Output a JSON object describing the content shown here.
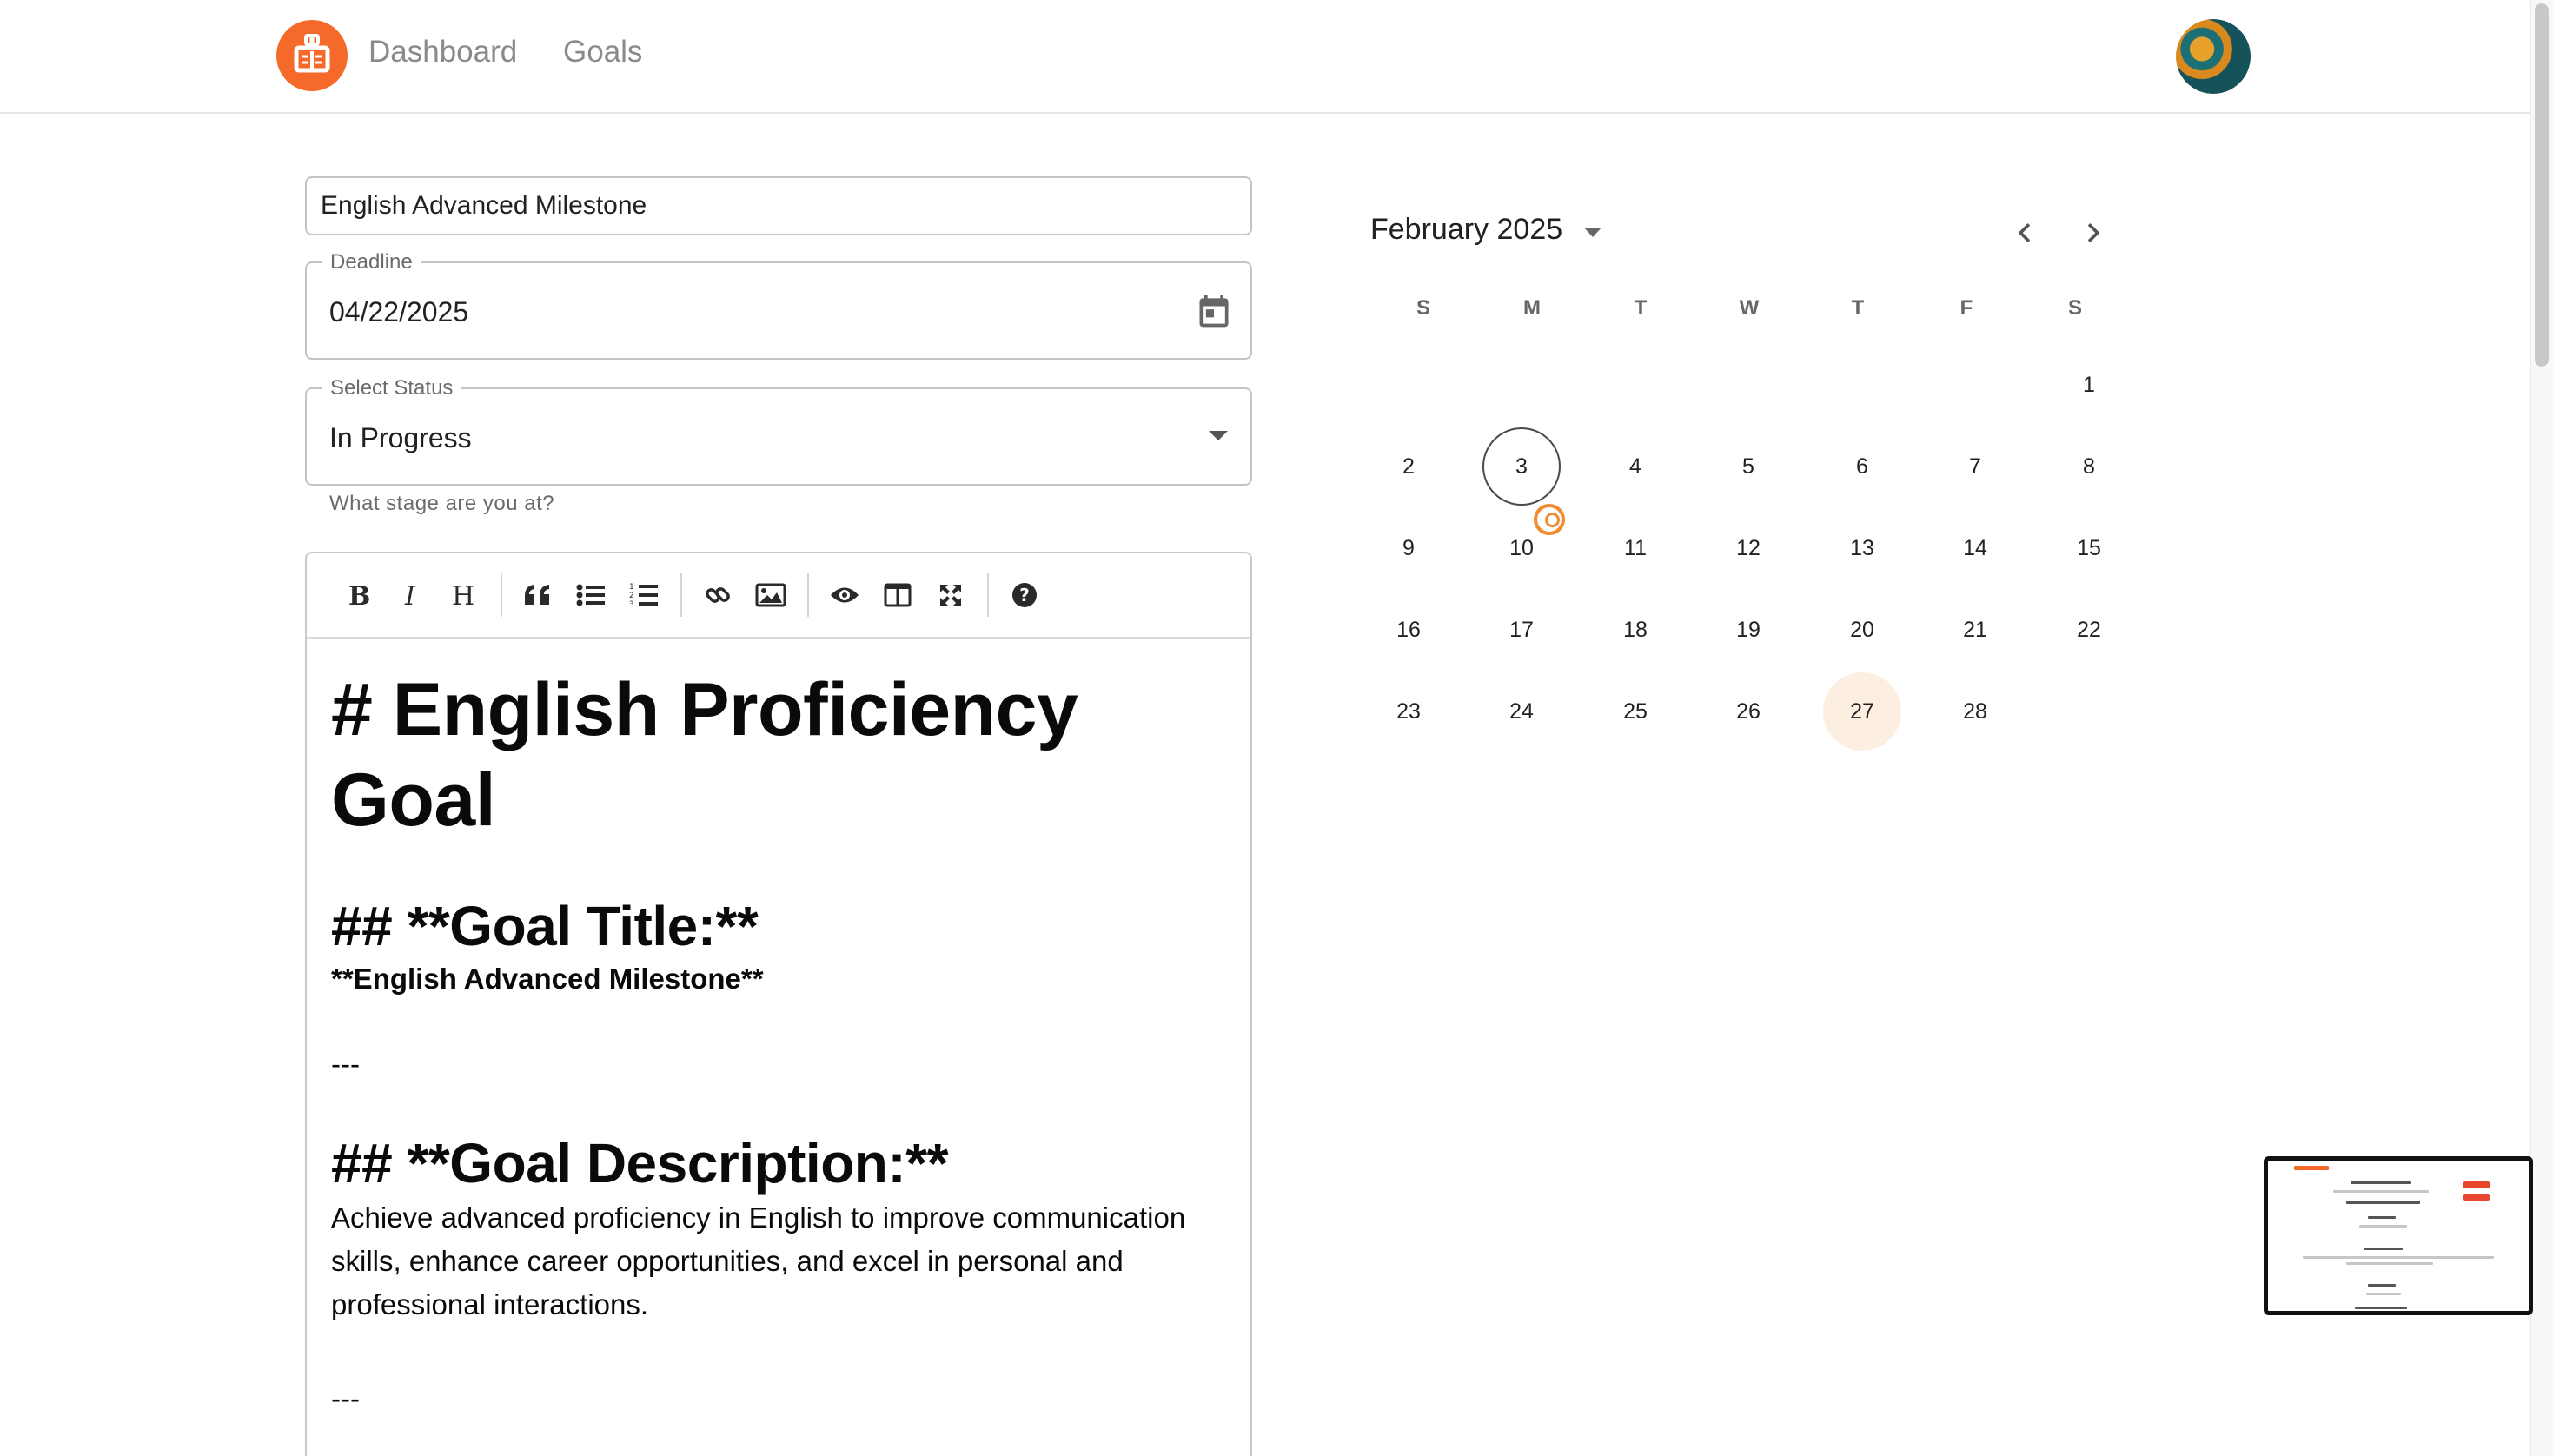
{
  "nav": {
    "links": [
      "Dashboard",
      "Goals"
    ]
  },
  "form": {
    "title_value": "English Advanced Milestone",
    "deadline": {
      "label": "Deadline",
      "value": "04/22/2025"
    },
    "status": {
      "label": "Select Status",
      "value": "In Progress",
      "helper": "What stage are you at?"
    }
  },
  "editor": {
    "toolbar": [
      "bold",
      "italic",
      "heading",
      "quote",
      "unordered-list",
      "ordered-list",
      "link",
      "image",
      "preview",
      "side-by-side",
      "fullscreen",
      "guide"
    ],
    "lines": {
      "h1": "# English Proficiency Goal",
      "h2_title": "## **Goal Title:**",
      "title_bold": "**English Advanced Milestone**",
      "hr1": "---",
      "h2_description": "## **Goal Description:**",
      "description": "Achieve advanced proficiency in English to improve communication skills, enhance career opportunities, and excel in personal and professional interactions.",
      "hr2": "---"
    }
  },
  "calendar": {
    "month_label": "February 2025",
    "weekdays": [
      "S",
      "M",
      "T",
      "W",
      "T",
      "F",
      "S"
    ],
    "days": [
      "1",
      "2",
      "3",
      "4",
      "5",
      "6",
      "7",
      "8",
      "9",
      "10",
      "11",
      "12",
      "13",
      "14",
      "15",
      "16",
      "17",
      "18",
      "19",
      "20",
      "21",
      "22",
      "23",
      "24",
      "25",
      "26",
      "27",
      "28"
    ],
    "first_weekday_index": 6,
    "today": "3",
    "selected": "27"
  },
  "colors": {
    "brand": "#f56a2a",
    "selected_day_bg": "#fdeee2",
    "marker": "#f28b2f"
  }
}
